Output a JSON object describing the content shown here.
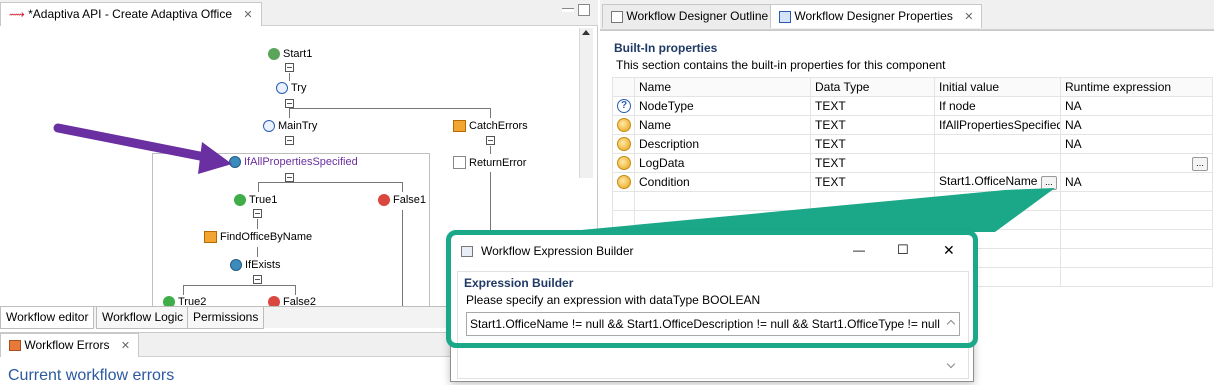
{
  "editor": {
    "tab_title": "*Adaptiva API - Create Adaptiva Office",
    "nodes": {
      "start": "Start1",
      "try": "Try",
      "main_try": "MainTry",
      "catch_errors": "CatchErrors",
      "return_error": "ReturnError",
      "if_all": "IfAllPropertiesSpecified",
      "true1": "True1",
      "false1": "False1",
      "find_office": "FindOfficeByName",
      "if_exists": "IfExists",
      "true2": "True2",
      "false2": "False2"
    },
    "bottom_tabs": [
      "Workflow editor",
      "Workflow Logic",
      "Permissions"
    ]
  },
  "errors": {
    "tab_title": "Workflow Errors",
    "heading": "Current workflow errors"
  },
  "properties": {
    "tabs": [
      "Workflow Designer Outline",
      "Workflow Designer Properties"
    ],
    "section_title": "Built-In properties",
    "section_desc": "This section contains the built-in properties for this component",
    "columns": [
      "Name",
      "Data Type",
      "Initial value",
      "Runtime expression"
    ],
    "rows": [
      {
        "name": "NodeType",
        "type": "TEXT",
        "initial": "If node",
        "runtime": "NA"
      },
      {
        "name": "Name",
        "type": "TEXT",
        "initial": "IfAllPropertiesSpecified",
        "runtime": "NA"
      },
      {
        "name": "Description",
        "type": "TEXT",
        "initial": "",
        "runtime": "NA"
      },
      {
        "name": "LogData",
        "type": "TEXT",
        "initial": "",
        "runtime": "..."
      },
      {
        "name": "Condition",
        "type": "TEXT",
        "initial": "Start1.OfficeName",
        "runtime": "NA"
      }
    ],
    "ellipsis": "..."
  },
  "dialog": {
    "title": "Workflow Expression Builder",
    "section_title": "Expression Builder",
    "description": "Please specify an expression with dataType BOOLEAN",
    "expression": "Start1.OfficeName != null && Start1.OfficeDescription != null && Start1.OfficeType != null",
    "minimize": "—",
    "maximize": "☐",
    "close": "✕"
  },
  "colors": {
    "highlight": "#1aa889",
    "arrow": "#6a2fa0",
    "section_blue": "#1f3a64"
  }
}
